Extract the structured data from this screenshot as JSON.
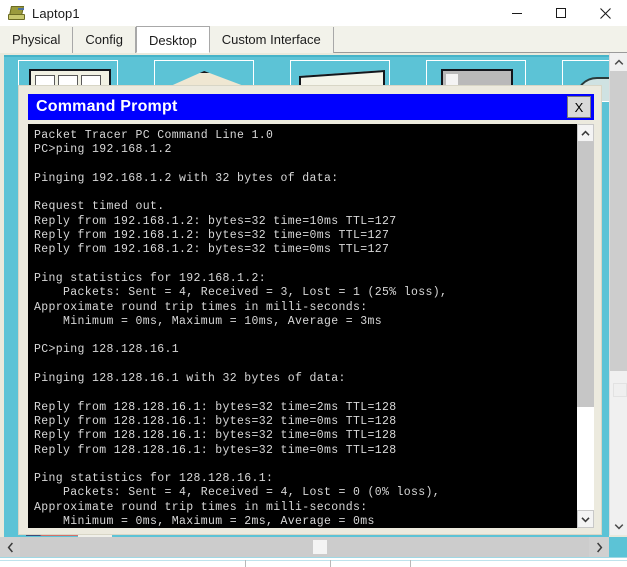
{
  "window": {
    "title": "Laptop1",
    "icon": "laptop-icon",
    "buttons": {
      "minimize": "minimize-icon",
      "maximize": "maximize-icon",
      "close": "close-icon"
    }
  },
  "tabs": [
    {
      "label": "Physical",
      "active": false
    },
    {
      "label": "Config",
      "active": false
    },
    {
      "label": "Desktop",
      "active": true
    },
    {
      "label": "Custom Interface",
      "active": false
    }
  ],
  "command_prompt": {
    "title": "Command Prompt",
    "close_label": "X",
    "terminal_text": "Packet Tracer PC Command Line 1.0\nPC>ping 192.168.1.2\n\nPinging 192.168.1.2 with 32 bytes of data:\n\nRequest timed out.\nReply from 192.168.1.2: bytes=32 time=10ms TTL=127\nReply from 192.168.1.2: bytes=32 time=0ms TTL=127\nReply from 192.168.1.2: bytes=32 time=0ms TTL=127\n\nPing statistics for 192.168.1.2:\n    Packets: Sent = 4, Received = 3, Lost = 1 (25% loss),\nApproximate round trip times in milli-seconds:\n    Minimum = 0ms, Maximum = 10ms, Average = 3ms\n\nPC>ping 128.128.16.1\n\nPinging 128.128.16.1 with 32 bytes of data:\n\nReply from 128.128.16.1: bytes=32 time=2ms TTL=128\nReply from 128.128.16.1: bytes=32 time=0ms TTL=128\nReply from 128.128.16.1: bytes=32 time=0ms TTL=128\nReply from 128.128.16.1: bytes=32 time=0ms TTL=128\n\nPing statistics for 128.128.16.1:\n    Packets: Sent = 4, Received = 4, Lost = 0 (0% loss),\nApproximate round trip times in milli-seconds:\n    Minimum = 0ms, Maximum = 2ms, Average = 0ms",
    "scrollbar": {
      "up_arrow": "chevron-up-icon",
      "down_arrow": "chevron-down-icon"
    }
  },
  "desktop": {
    "background_color": "#5cc3d6",
    "icon_tiles": [
      "icon-tile-1",
      "icon-tile-2",
      "icon-tile-3",
      "icon-tile-4",
      "icon-tile-5"
    ]
  },
  "panel_scrollbars": {
    "vertical": {
      "up_arrow": "chevron-up-icon",
      "down_arrow": "chevron-down-icon"
    },
    "horizontal": {
      "left_arrow": "chevron-left-icon",
      "right_arrow": "chevron-right-icon"
    }
  },
  "colors": {
    "desktop_teal": "#5cc3d6",
    "title_blue": "#0000ff",
    "window_beige": "#eceade",
    "terminal_bg": "#000000",
    "terminal_fg": "#d8d8d8"
  }
}
